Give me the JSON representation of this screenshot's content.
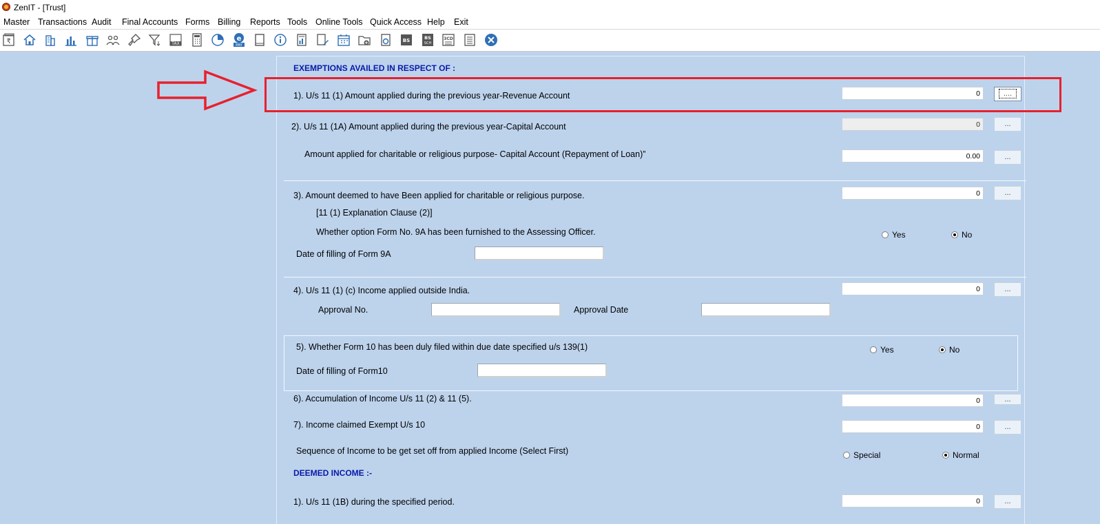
{
  "window": {
    "title": "ZenIT - [Trust]"
  },
  "menu": [
    "Master",
    "Transactions",
    "Audit",
    "Final Accounts",
    "Forms",
    "Billing",
    "Reports",
    "Tools",
    "Online Tools",
    "Quick Access",
    "Help",
    "Exit"
  ],
  "toolbar": {
    "icons": [
      "rupee-book-icon",
      "home-icon",
      "building-icon",
      "bar-chart-icon",
      "gift-icon",
      "users-icon",
      "pin-icon",
      "filter-icon",
      "tax-icon",
      "calculator-icon",
      "pie-chart-icon",
      "epay-icon",
      "book-icon",
      "info-icon",
      "report-icon",
      "edit-document-icon",
      "calendar-icon",
      "folder-add-icon",
      "refresh-document-icon",
      "bs-icon",
      "bs-schedule-icon",
      "3cd-icon",
      "register-icon",
      "close-circle-icon"
    ],
    "tax_label": "TAX",
    "pay_label": "PAY",
    "e_label": "e",
    "bs_label": "BS",
    "sch_label": "SCH",
    "cd_label": "3CD"
  },
  "form": {
    "heading_exemptions": "EXEMPTIONS AVAILED IN RESPECT OF :",
    "item1": {
      "label": "1). U/s 11 (1) Amount applied during the previous year-Revenue Account",
      "value": "0",
      "button": "...."
    },
    "item2": {
      "label": "2). U/s 11 (1A) Amount applied during the previous year-Capital Account",
      "value": "0",
      "button": "..."
    },
    "item2b": {
      "label": "Amount applied for charitable or religious purpose- Capital Account (Repayment of Loan)”",
      "value": "0.00",
      "button": "..."
    },
    "item3": {
      "label": "3).  Amount deemed to have Been applied for charitable or religious purpose.",
      "sub_label": "[11 (1) Explanation Clause (2)]",
      "question": "Whether option Form No. 9A has been furnished to the Assessing Officer.",
      "value": "0",
      "button": "...",
      "yes": "Yes",
      "no": "No",
      "selected": "No",
      "date_label": "Date of filling of Form 9A",
      "date_value": ""
    },
    "item4": {
      "label": "4).  U/s 11 (1) (c) Income applied outside India.",
      "value": "0",
      "button": "...",
      "approval_no_label": "Approval No.",
      "approval_no": "",
      "approval_date_label": "Approval Date",
      "approval_date": ""
    },
    "item5": {
      "label": "5). Whether Form 10 has been duly filed within due date specified u/s 139(1)",
      "yes": "Yes",
      "no": "No",
      "selected": "No",
      "date_label": "Date of filling of Form10",
      "date_value": ""
    },
    "item6": {
      "label": "6).  Accumulation of Income U/s 11 (2) & 11 (5).",
      "value": "0",
      "button": "..."
    },
    "item7": {
      "label": "7).  Income claimed Exempt U/s 10",
      "value": "0",
      "button": "..."
    },
    "sequence": {
      "label": "Sequence of Income to be get set off from applied Income (Select First)",
      "special": "Special",
      "normal": "Normal",
      "selected": "Normal"
    },
    "heading_deemed": "DEEMED INCOME :-",
    "deemed1": {
      "label": "1).  U/s 11 (1B) during the specified period.",
      "value": "0",
      "button": "..."
    }
  }
}
